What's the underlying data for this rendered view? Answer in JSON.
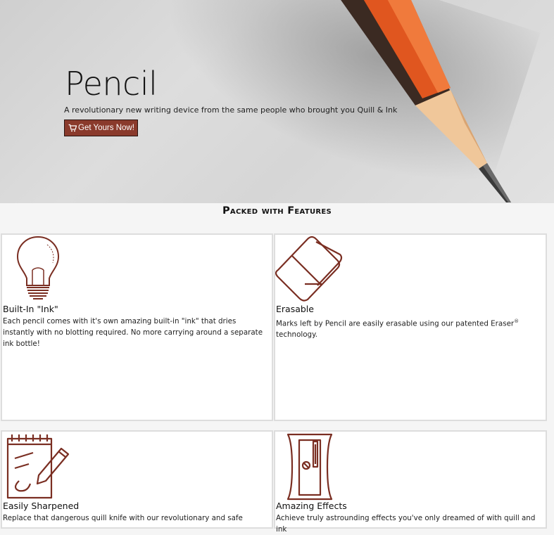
{
  "hero": {
    "title": "Pencil",
    "subtitle": "A revolutionary new writing device from the same people who brought you Quill & Ink",
    "cta_label": "Get Yours Now!",
    "cta_icon": "shopping-cart-icon"
  },
  "features": {
    "heading": "Packed with Features",
    "items": [
      {
        "icon": "lightbulb-icon",
        "title": "Built-In \"Ink\"",
        "text": "Each pencil comes with it's own amazing built-in \"ink\" that dries instantly with no blotting required. No more carrying around a separate ink bottle!"
      },
      {
        "icon": "eraser-icon",
        "title": "Erasable",
        "text": "Marks left by Pencil are easily erasable using our patented Eraser",
        "text_sup": "®",
        "text_tail": " technology."
      },
      {
        "icon": "notepad-pencil-icon",
        "title": "Easily Sharpened",
        "text": "Replace that dangerous quill knife with our revolutionary and safe"
      },
      {
        "icon": "sharpener-icon",
        "title": "Amazing Effects",
        "text": "Achieve truly astrounding effects you've only dreamed of with quill and ink"
      }
    ]
  },
  "colors": {
    "accent": "#8a3a2c",
    "icon_stroke": "#7a2e22",
    "pencil_orange": "#e0561f"
  }
}
